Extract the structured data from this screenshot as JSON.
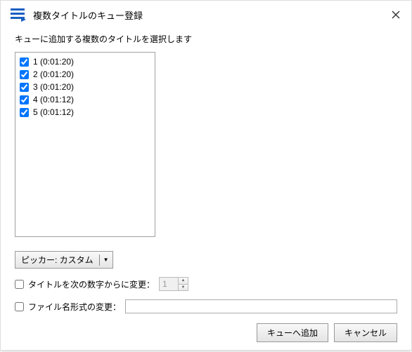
{
  "header": {
    "title": "複数タイトルのキュー登録"
  },
  "instruction": "キューに追加する複数のタイトルを選択します",
  "titles": [
    {
      "checked": true,
      "label": "1 (0:01:20)"
    },
    {
      "checked": true,
      "label": "2 (0:01:20)"
    },
    {
      "checked": true,
      "label": "3 (0:01:20)"
    },
    {
      "checked": true,
      "label": "4 (0:01:12)"
    },
    {
      "checked": true,
      "label": "5 (0:01:12)"
    }
  ],
  "picker": {
    "label": "ピッカー: カスタム"
  },
  "options": {
    "renumber": {
      "checked": false,
      "label": "タイトルを次の数字からに変更：",
      "value": "1"
    },
    "filename": {
      "checked": false,
      "label": "ファイル名形式の変更：",
      "value": ""
    }
  },
  "buttons": {
    "add": "キューへ追加",
    "cancel": "キャンセル"
  }
}
